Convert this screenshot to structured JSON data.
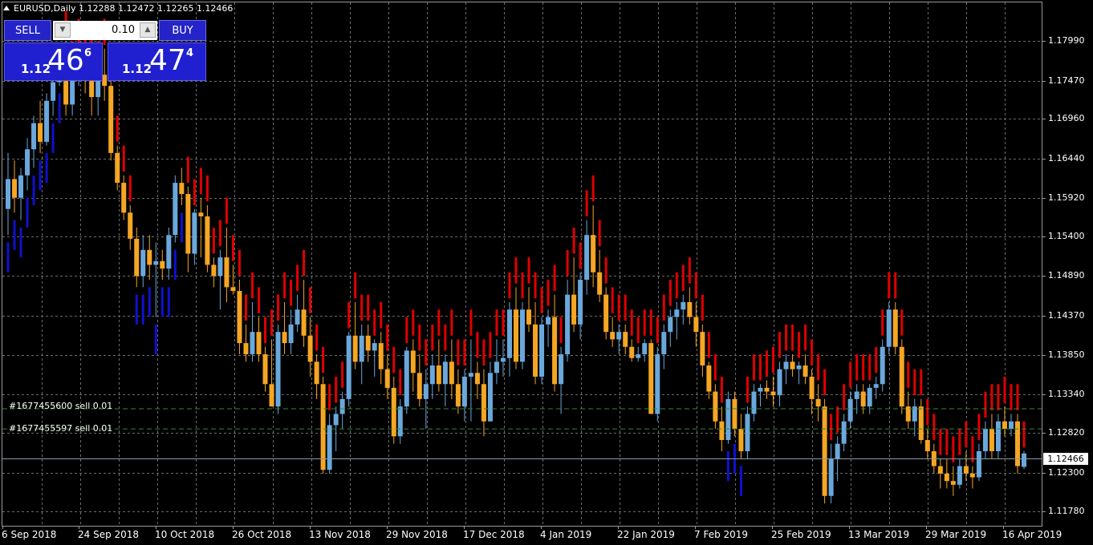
{
  "header": {
    "symbol": "EURUSD,Daily",
    "ohlc": "1.12288 1.12472 1.12265 1.12466"
  },
  "trade_panel": {
    "sell_label": "SELL",
    "buy_label": "BUY",
    "lot_value": "0.10",
    "sell_price": {
      "prefix": "1.12",
      "big": "46",
      "small": "6"
    },
    "buy_price": {
      "prefix": "1.12",
      "big": "47",
      "small": "4"
    }
  },
  "orders": [
    {
      "label": "#1677455600 sell 0.01",
      "price": 1.1307
    },
    {
      "label": "#1677455597 sell 0.01",
      "price": 1.128
    }
  ],
  "current_price": {
    "label": "1.12466",
    "value": 1.12466
  },
  "y_axis": {
    "ticks": [
      "1.17990",
      "1.17470",
      "1.16960",
      "1.16440",
      "1.15920",
      "1.15400",
      "1.14890",
      "1.14370",
      "1.13850",
      "1.13340",
      "1.12820",
      "1.12300",
      "1.11780"
    ]
  },
  "x_axis": {
    "ticks": [
      "6 Sep 2018",
      "24 Sep 2018",
      "10 Oct 2018",
      "26 Oct 2018",
      "13 Nov 2018",
      "29 Nov 2018",
      "17 Dec 2018",
      "4 Jan 2019",
      "22 Jan 2019",
      "7 Feb 2019",
      "25 Feb 2019",
      "13 Mar 2019",
      "29 Mar 2019",
      "16 Apr 2019"
    ]
  },
  "colors": {
    "background": "#000000",
    "grid": "#6b6b6b",
    "bull": "#6aa8dc",
    "bear": "#f5a623",
    "indicator_up": "#e00000",
    "indicator_down": "#1010d0",
    "order_line": "#2e8b2e"
  },
  "chart_data": {
    "type": "candlestick",
    "symbol": "EURUSD",
    "timeframe": "Daily",
    "y_range": [
      1.115,
      1.1852
    ],
    "candles": [
      [
        1.1575,
        1.165,
        1.154,
        1.1615
      ],
      [
        1.1615,
        1.164,
        1.157,
        1.159
      ],
      [
        1.159,
        1.163,
        1.156,
        1.162
      ],
      [
        1.162,
        1.167,
        1.16,
        1.1655
      ],
      [
        1.1655,
        1.17,
        1.163,
        1.169
      ],
      [
        1.169,
        1.172,
        1.165,
        1.1665
      ],
      [
        1.1665,
        1.173,
        1.166,
        1.172
      ],
      [
        1.172,
        1.175,
        1.17,
        1.1745
      ],
      [
        1.1745,
        1.179,
        1.174,
        1.1785
      ],
      [
        1.1785,
        1.18,
        1.17,
        1.1715
      ],
      [
        1.1715,
        1.176,
        1.17,
        1.175
      ],
      [
        1.175,
        1.179,
        1.174,
        1.177
      ],
      [
        1.177,
        1.178,
        1.173,
        1.176
      ],
      [
        1.176,
        1.178,
        1.17,
        1.1725
      ],
      [
        1.1725,
        1.176,
        1.17,
        1.1755
      ],
      [
        1.1755,
        1.179,
        1.172,
        1.174
      ],
      [
        1.174,
        1.175,
        1.164,
        1.165
      ],
      [
        1.165,
        1.166,
        1.16,
        1.161
      ],
      [
        1.161,
        1.162,
        1.156,
        1.157
      ],
      [
        1.157,
        1.158,
        1.152,
        1.1535
      ],
      [
        1.1535,
        1.155,
        1.147,
        1.1485
      ],
      [
        1.1485,
        1.154,
        1.147,
        1.152
      ],
      [
        1.152,
        1.154,
        1.148,
        1.15
      ],
      [
        1.15,
        1.153,
        1.143,
        1.1505
      ],
      [
        1.1505,
        1.152,
        1.148,
        1.1495
      ],
      [
        1.1495,
        1.155,
        1.148,
        1.154
      ],
      [
        1.154,
        1.162,
        1.153,
        1.161
      ],
      [
        1.161,
        1.163,
        1.158,
        1.1595
      ],
      [
        1.1595,
        1.1605,
        1.149,
        1.1515
      ],
      [
        1.1515,
        1.1575,
        1.15,
        1.157
      ],
      [
        1.157,
        1.159,
        1.151,
        1.1565
      ],
      [
        1.1565,
        1.158,
        1.149,
        1.15
      ],
      [
        1.15,
        1.151,
        1.147,
        1.1485
      ],
      [
        1.1485,
        1.152,
        1.144,
        1.151
      ],
      [
        1.151,
        1.155,
        1.145,
        1.147
      ],
      [
        1.147,
        1.15,
        1.146,
        1.1465
      ],
      [
        1.1465,
        1.148,
        1.138,
        1.1395
      ],
      [
        1.1395,
        1.142,
        1.137,
        1.138
      ],
      [
        1.138,
        1.145,
        1.137,
        1.141
      ],
      [
        1.141,
        1.143,
        1.137,
        1.138
      ],
      [
        1.138,
        1.139,
        1.133,
        1.134
      ],
      [
        1.134,
        1.14,
        1.131,
        1.131
      ],
      [
        1.131,
        1.142,
        1.13,
        1.141
      ],
      [
        1.141,
        1.145,
        1.138,
        1.1395
      ],
      [
        1.1395,
        1.144,
        1.138,
        1.142
      ],
      [
        1.142,
        1.146,
        1.141,
        1.144
      ],
      [
        1.144,
        1.148,
        1.139,
        1.1405
      ],
      [
        1.1405,
        1.143,
        1.135,
        1.137
      ],
      [
        1.137,
        1.138,
        1.132,
        1.134
      ],
      [
        1.134,
        1.135,
        1.122,
        1.1225
      ],
      [
        1.1225,
        1.13,
        1.122,
        1.1285
      ],
      [
        1.1285,
        1.131,
        1.125,
        1.13
      ],
      [
        1.13,
        1.133,
        1.128,
        1.132
      ],
      [
        1.132,
        1.141,
        1.131,
        1.1405
      ],
      [
        1.1405,
        1.145,
        1.136,
        1.137
      ],
      [
        1.137,
        1.142,
        1.134,
        1.1405
      ],
      [
        1.1405,
        1.142,
        1.137,
        1.1385
      ],
      [
        1.1385,
        1.14,
        1.135,
        1.1395
      ],
      [
        1.1395,
        1.141,
        1.134,
        1.136
      ],
      [
        1.136,
        1.138,
        1.132,
        1.1335
      ],
      [
        1.1335,
        1.135,
        1.126,
        1.127
      ],
      [
        1.127,
        1.132,
        1.126,
        1.131
      ],
      [
        1.131,
        1.139,
        1.13,
        1.1385
      ],
      [
        1.1385,
        1.14,
        1.133,
        1.1355
      ],
      [
        1.1355,
        1.138,
        1.131,
        1.132
      ],
      [
        1.132,
        1.136,
        1.128,
        1.134
      ],
      [
        1.134,
        1.138,
        1.132,
        1.1365
      ],
      [
        1.1365,
        1.14,
        1.133,
        1.134
      ],
      [
        1.134,
        1.138,
        1.131,
        1.137
      ],
      [
        1.137,
        1.14,
        1.132,
        1.134
      ],
      [
        1.134,
        1.136,
        1.13,
        1.131
      ],
      [
        1.131,
        1.136,
        1.129,
        1.135
      ],
      [
        1.135,
        1.14,
        1.129,
        1.1355
      ],
      [
        1.1355,
        1.137,
        1.132,
        1.134
      ],
      [
        1.134,
        1.136,
        1.127,
        1.129
      ],
      [
        1.129,
        1.137,
        1.129,
        1.1355
      ],
      [
        1.1355,
        1.14,
        1.134,
        1.137
      ],
      [
        1.137,
        1.14,
        1.135,
        1.1375
      ],
      [
        1.1375,
        1.145,
        1.135,
        1.144
      ],
      [
        1.144,
        1.147,
        1.136,
        1.137
      ],
      [
        1.137,
        1.145,
        1.136,
        1.144
      ],
      [
        1.144,
        1.147,
        1.141,
        1.142
      ],
      [
        1.142,
        1.145,
        1.134,
        1.135
      ],
      [
        1.135,
        1.143,
        1.134,
        1.142
      ],
      [
        1.142,
        1.144,
        1.139,
        1.143
      ],
      [
        1.143,
        1.146,
        1.133,
        1.134
      ],
      [
        1.134,
        1.139,
        1.13,
        1.138
      ],
      [
        1.138,
        1.148,
        1.137,
        1.146
      ],
      [
        1.146,
        1.151,
        1.141,
        1.142
      ],
      [
        1.142,
        1.149,
        1.14,
        1.148
      ],
      [
        1.148,
        1.156,
        1.146,
        1.154
      ],
      [
        1.154,
        1.158,
        1.147,
        1.149
      ],
      [
        1.149,
        1.152,
        1.145,
        1.146
      ],
      [
        1.146,
        1.147,
        1.14,
        1.141
      ],
      [
        1.141,
        1.143,
        1.139,
        1.14
      ],
      [
        1.14,
        1.142,
        1.138,
        1.141
      ],
      [
        1.141,
        1.142,
        1.138,
        1.139
      ],
      [
        1.139,
        1.14,
        1.137,
        1.1375
      ],
      [
        1.1375,
        1.139,
        1.137,
        1.138
      ],
      [
        1.138,
        1.14,
        1.137,
        1.1395
      ],
      [
        1.1395,
        1.14,
        1.13,
        1.13
      ],
      [
        1.13,
        1.139,
        1.129,
        1.138
      ],
      [
        1.138,
        1.142,
        1.136,
        1.141
      ],
      [
        1.141,
        1.144,
        1.139,
        1.143
      ],
      [
        1.143,
        1.145,
        1.14,
        1.144
      ],
      [
        1.144,
        1.146,
        1.142,
        1.145
      ],
      [
        1.145,
        1.147,
        1.142,
        1.143
      ],
      [
        1.143,
        1.145,
        1.139,
        1.141
      ],
      [
        1.141,
        1.142,
        1.135,
        1.1365
      ],
      [
        1.1365,
        1.137,
        1.132,
        1.133
      ],
      [
        1.133,
        1.134,
        1.128,
        1.129
      ],
      [
        1.129,
        1.131,
        1.125,
        1.1265
      ],
      [
        1.1265,
        1.133,
        1.126,
        1.132
      ],
      [
        1.132,
        1.133,
        1.127,
        1.128
      ],
      [
        1.128,
        1.13,
        1.124,
        1.125
      ],
      [
        1.125,
        1.131,
        1.124,
        1.13
      ],
      [
        1.13,
        1.134,
        1.129,
        1.133
      ],
      [
        1.133,
        1.134,
        1.131,
        1.1335
      ],
      [
        1.1335,
        1.1345,
        1.132,
        1.133
      ],
      [
        1.133,
        1.135,
        1.131,
        1.1325
      ],
      [
        1.1325,
        1.137,
        1.131,
        1.136
      ],
      [
        1.136,
        1.138,
        1.134,
        1.137
      ],
      [
        1.137,
        1.138,
        1.135,
        1.136
      ],
      [
        1.136,
        1.137,
        1.134,
        1.1365
      ],
      [
        1.1365,
        1.138,
        1.134,
        1.135
      ],
      [
        1.135,
        1.136,
        1.13,
        1.132
      ],
      [
        1.132,
        1.134,
        1.129,
        1.131
      ],
      [
        1.131,
        1.132,
        1.118,
        1.119
      ],
      [
        1.119,
        1.126,
        1.118,
        1.124
      ],
      [
        1.124,
        1.127,
        1.121,
        1.126
      ],
      [
        1.126,
        1.13,
        1.125,
        1.129
      ],
      [
        1.129,
        1.133,
        1.128,
        1.132
      ],
      [
        1.132,
        1.134,
        1.13,
        1.133
      ],
      [
        1.133,
        1.134,
        1.13,
        1.131
      ],
      [
        1.131,
        1.134,
        1.13,
        1.1335
      ],
      [
        1.1335,
        1.135,
        1.132,
        1.134
      ],
      [
        1.134,
        1.14,
        1.133,
        1.139
      ],
      [
        1.139,
        1.145,
        1.138,
        1.144
      ],
      [
        1.144,
        1.145,
        1.138,
        1.139
      ],
      [
        1.139,
        1.14,
        1.13,
        1.131
      ],
      [
        1.131,
        1.133,
        1.128,
        1.129
      ],
      [
        1.129,
        1.132,
        1.127,
        1.131
      ],
      [
        1.131,
        1.132,
        1.126,
        1.1265
      ],
      [
        1.1265,
        1.128,
        1.124,
        1.125
      ],
      [
        1.125,
        1.126,
        1.122,
        1.123
      ],
      [
        1.123,
        1.124,
        1.12,
        1.122
      ],
      [
        1.122,
        1.124,
        1.12,
        1.121
      ],
      [
        1.121,
        1.123,
        1.119,
        1.1205
      ],
      [
        1.1205,
        1.124,
        1.12,
        1.123
      ],
      [
        1.123,
        1.125,
        1.121,
        1.122
      ],
      [
        1.122,
        1.123,
        1.12,
        1.1215
      ],
      [
        1.1215,
        1.126,
        1.121,
        1.125
      ],
      [
        1.125,
        1.129,
        1.124,
        1.128
      ],
      [
        1.128,
        1.13,
        1.124,
        1.125
      ],
      [
        1.125,
        1.13,
        1.124,
        1.129
      ],
      [
        1.129,
        1.131,
        1.127,
        1.128
      ],
      [
        1.128,
        1.13,
        1.127,
        1.129
      ],
      [
        1.129,
        1.13,
        1.122,
        1.123
      ],
      [
        1.1229,
        1.125,
        1.1226,
        1.1247
      ]
    ]
  }
}
